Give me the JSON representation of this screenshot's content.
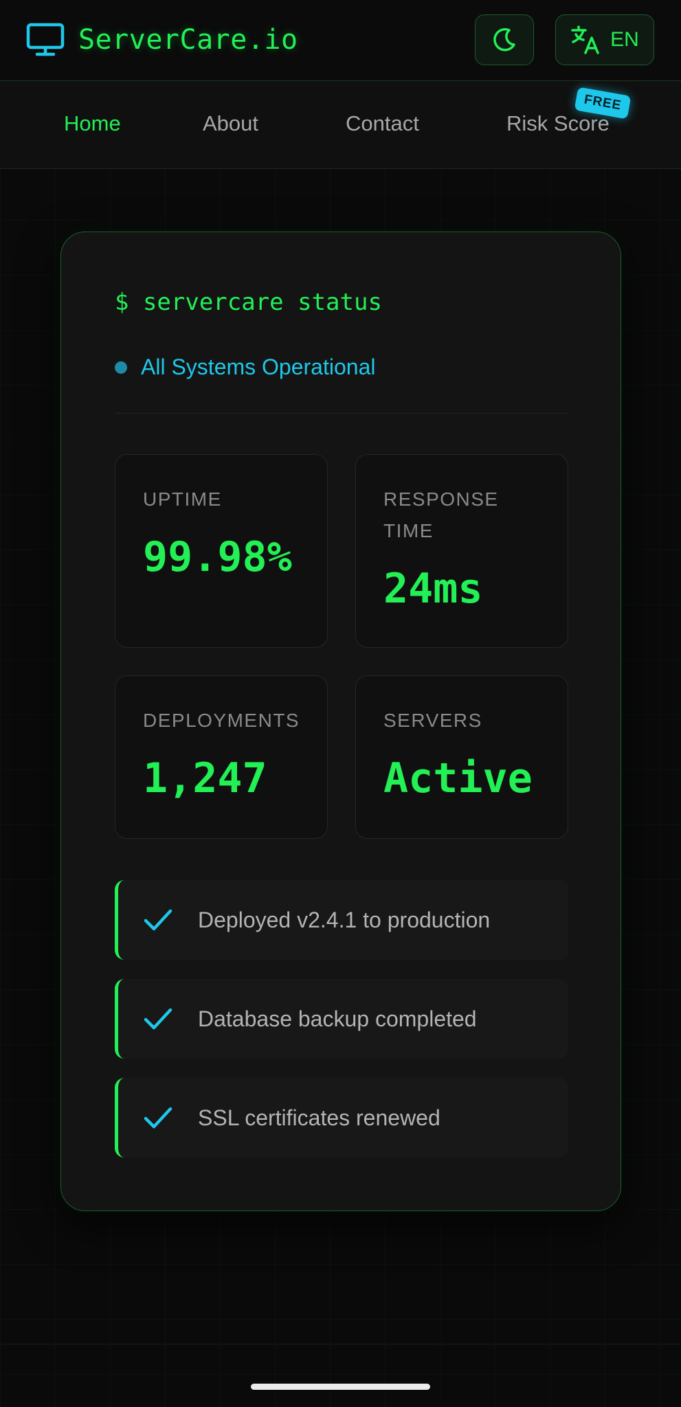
{
  "header": {
    "brand": "ServerCare.io",
    "logo_icon": "monitor-icon",
    "theme_toggle_icon": "moon-icon",
    "language_icon": "translate-icon",
    "language_label": "EN"
  },
  "nav": {
    "items": [
      {
        "label": "Home",
        "active": true
      },
      {
        "label": "About",
        "active": false
      },
      {
        "label": "Contact",
        "active": false
      },
      {
        "label": "Risk Score",
        "active": false
      }
    ],
    "badge": "FREE"
  },
  "status_card": {
    "command": "$ servercare status",
    "status_text": "All Systems Operational",
    "stats": [
      {
        "label": "UPTIME",
        "value": "99.98%"
      },
      {
        "label": "RESPONSE TIME",
        "value": "24ms"
      },
      {
        "label": "DEPLOYMENTS",
        "value": "1,247"
      },
      {
        "label": "SERVERS",
        "value": "Active"
      }
    ],
    "activity": [
      {
        "text": "Deployed v2.4.1 to production",
        "icon": "check-icon"
      },
      {
        "text": "Database backup completed",
        "icon": "check-icon"
      },
      {
        "text": "SSL certificates renewed",
        "icon": "check-icon"
      }
    ]
  },
  "colors": {
    "accent_green": "#22f055",
    "accent_cyan": "#1ec8ea",
    "background": "#0a0a0a",
    "card": "#141414"
  }
}
